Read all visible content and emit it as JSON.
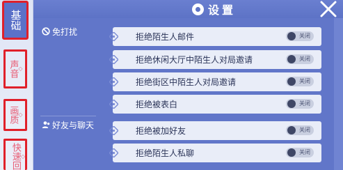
{
  "header": {
    "title": "设置"
  },
  "sidebar": {
    "tabs": [
      {
        "label": "基础",
        "active": true
      },
      {
        "label": "声音",
        "active": false
      },
      {
        "label": "画质",
        "active": false
      },
      {
        "label": "快速回",
        "active": false
      }
    ]
  },
  "sections": [
    {
      "label": "免打扰",
      "icon": "block-icon",
      "rows": [
        {
          "label": "拒绝陌生人邮件",
          "toggle": "关闭"
        },
        {
          "label": "拒绝休闲大厅中陌生人对局邀请",
          "toggle": "关闭"
        },
        {
          "label": "拒绝街区中陌生人对局邀请",
          "toggle": "关闭"
        },
        {
          "label": "拒绝被表白",
          "toggle": "关闭"
        }
      ]
    },
    {
      "label": "好友与聊天",
      "icon": "friends-icon",
      "rows": [
        {
          "label": "拒绝被加好友",
          "toggle": "关闭"
        },
        {
          "label": "拒绝陌生人私聊",
          "toggle": "关闭"
        }
      ]
    }
  ],
  "colors": {
    "accent": "#6176c9",
    "active_tab": "#5b71c8",
    "inactive_text": "#e85a72",
    "highlight_border": "#e0202a",
    "row_bg": "#e9edf8"
  }
}
